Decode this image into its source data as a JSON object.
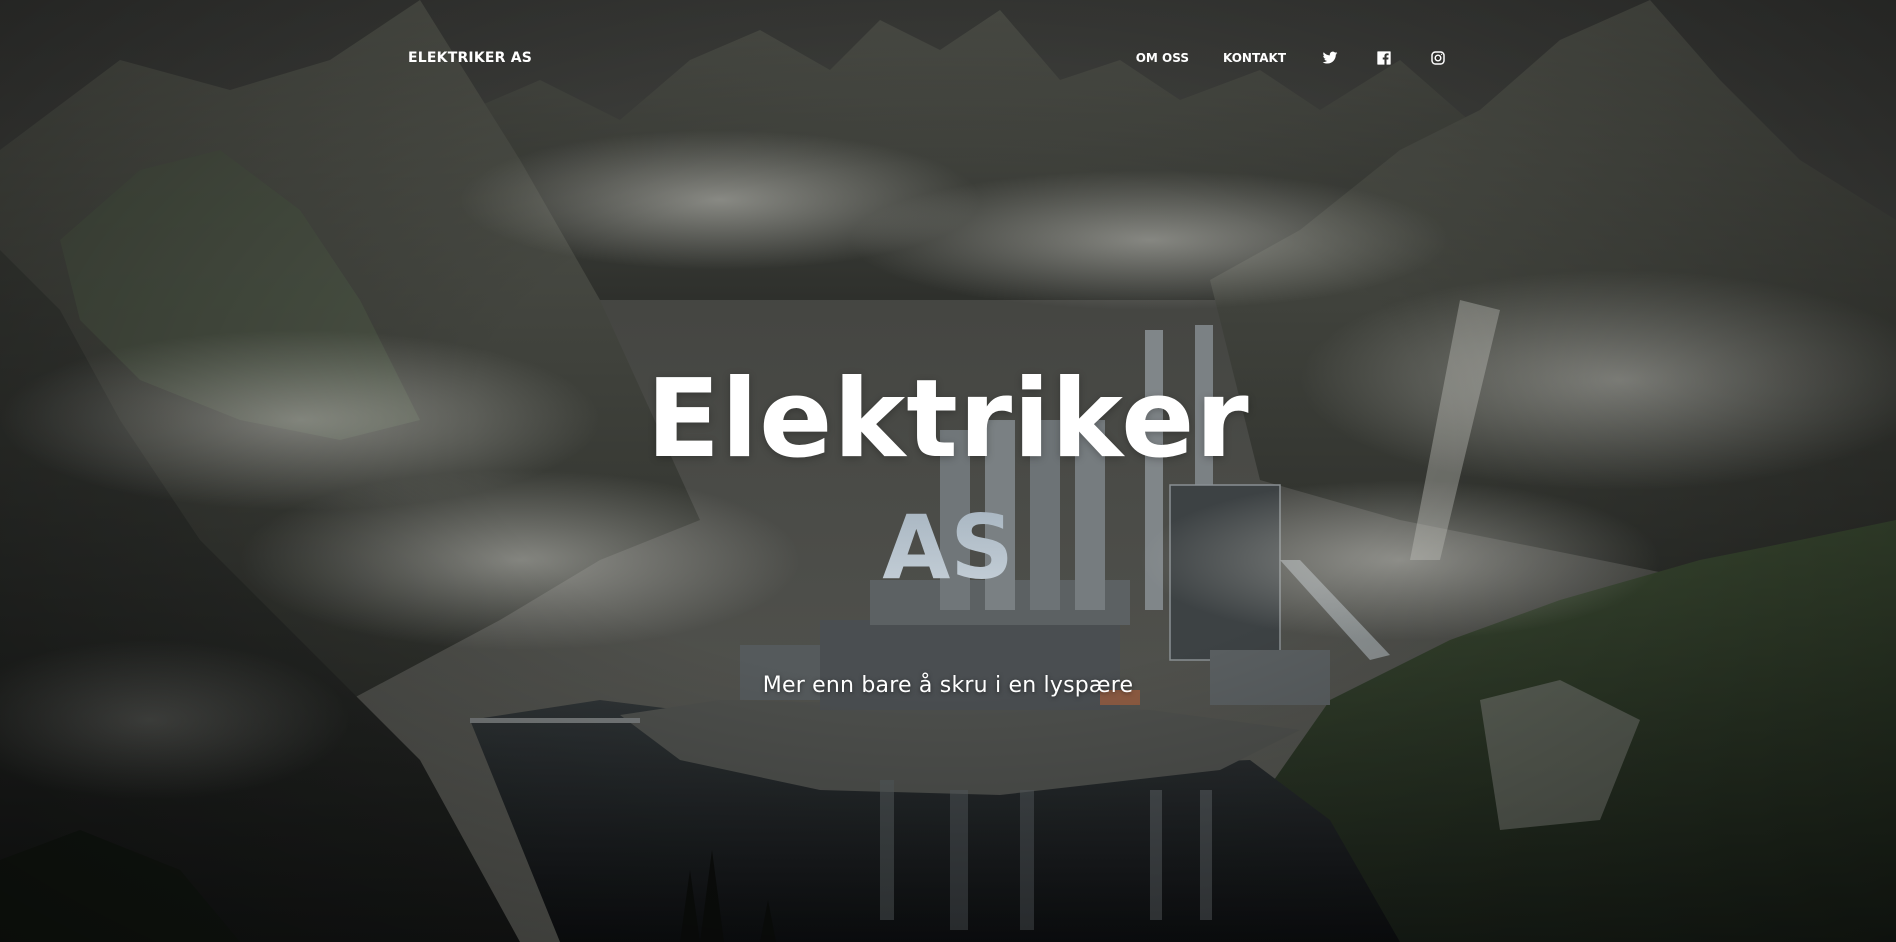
{
  "nav": {
    "brand": "ELEKTRIKER AS",
    "links": [
      {
        "label": "OM OSS"
      },
      {
        "label": "KONTAKT"
      }
    ],
    "social": [
      {
        "icon": "twitter-icon"
      },
      {
        "icon": "facebook-icon"
      },
      {
        "icon": "instagram-icon"
      }
    ]
  },
  "hero": {
    "title_line1": "Elektriker",
    "title_line2": "AS",
    "subtitle": "Mer enn bare å skru i en lyspære"
  },
  "colors": {
    "text": "#ffffff",
    "title_accent": "#a9b6c2",
    "background_dark": "#1b1d1c"
  }
}
